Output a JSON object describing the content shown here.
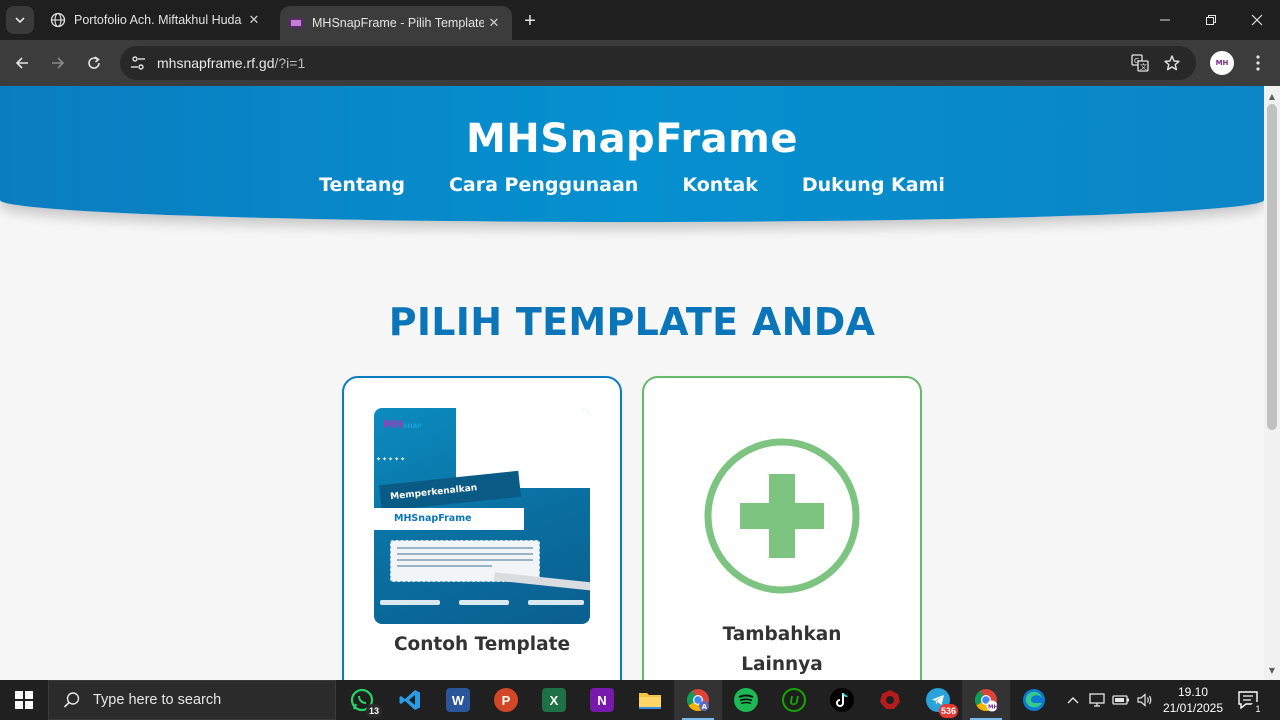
{
  "browser": {
    "tabs": [
      {
        "title": "Portofolio Ach. Miftakhul Huda",
        "active": false
      },
      {
        "title": "MHSnapFrame - Pilih Template",
        "active": true
      }
    ],
    "address": {
      "host": "mhsnapframe.rf.gd",
      "path": "/?i=1"
    },
    "profile_initials": "MH"
  },
  "site": {
    "brand": "MHSnapFrame",
    "nav": [
      "Tentang",
      "Cara Penggunaan",
      "Kontak",
      "Dukung Kami"
    ],
    "heading": "PILIH TEMPLATE ANDA",
    "cards": [
      {
        "label": "Contoh Template",
        "preview": {
          "logo": "MH",
          "logo_sub": "SNAP",
          "ribbon_top": "Memperkenalkan",
          "ribbon_bottom": "MHSnapFrame"
        }
      },
      {
        "label_line1": "Tambahkan",
        "label_line2": "Lainnya",
        "icon": "plus-circle-icon"
      }
    ]
  },
  "colors": {
    "header_blue": "#0590cf",
    "heading_blue": "#0a75b9",
    "card_border_blue": "#0a7dc0",
    "add_green": "#66bb6a",
    "plus_green": "#7cc47f"
  },
  "taskbar": {
    "search_placeholder": "Type here to search",
    "apps": [
      {
        "name": "whatsapp",
        "badge": "13"
      },
      {
        "name": "vscode"
      },
      {
        "name": "word"
      },
      {
        "name": "powerpoint"
      },
      {
        "name": "excel"
      },
      {
        "name": "onenote"
      },
      {
        "name": "file-explorer"
      },
      {
        "name": "chrome-profile-a"
      },
      {
        "name": "spotify"
      },
      {
        "name": "upwork"
      },
      {
        "name": "tiktok"
      },
      {
        "name": "app-red"
      },
      {
        "name": "telegram",
        "badge": "536"
      },
      {
        "name": "chrome-profile-mh"
      },
      {
        "name": "edge"
      }
    ],
    "time": "19.10",
    "date": "21/01/2025",
    "notification_count": "1"
  }
}
